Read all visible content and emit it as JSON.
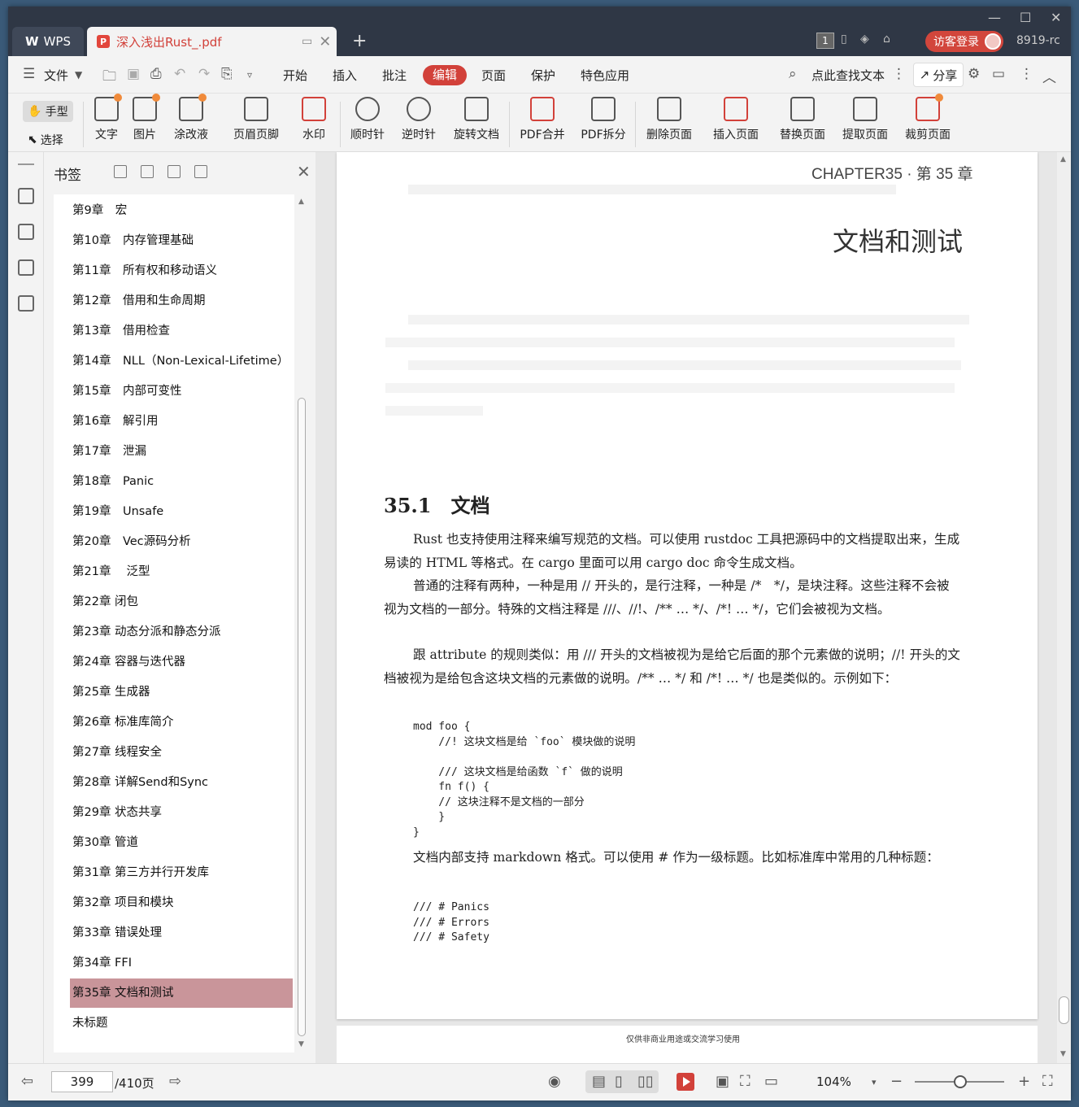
{
  "titlebar": {
    "wps_label": "WPS",
    "doc_tab_title": "深入浅出Rust_.pdf",
    "page_badge": "1",
    "login_label": "访客登录",
    "version": "8919-rc"
  },
  "menu": {
    "file": "文件",
    "items": [
      "开始",
      "插入",
      "批注",
      "编辑",
      "页面",
      "保护",
      "特色应用"
    ],
    "search_text": "点此查找文本",
    "share": "分享"
  },
  "ribbon": {
    "hand": "手型",
    "select": "选择",
    "tools": [
      "文字",
      "图片",
      "涂改液",
      "页眉页脚",
      "水印",
      "顺时针",
      "逆时针",
      "旋转文档",
      "PDF合并",
      "PDF拆分",
      "删除页面",
      "插入页面",
      "替换页面",
      "提取页面",
      "裁剪页面"
    ]
  },
  "bookmark": {
    "title": "书签",
    "items": [
      "第9章　宏",
      "第10章　内存管理基础",
      "第11章　所有权和移动语义",
      "第12章　借用和生命周期",
      "第13章　借用检查",
      "第14章　NLL（Non-Lexical-Lifetime）",
      "第15章　内部可变性",
      "第16章　解引用",
      "第17章　泄漏",
      "第18章　Panic",
      "第19章　Unsafe",
      "第20章　Vec源码分析",
      "第21章　 泛型",
      "第22章 闭包",
      "第23章 动态分派和静态分派",
      "第24章 容器与迭代器",
      "第25章 生成器",
      "第26章 标准库简介",
      "第27章 线程安全",
      "第28章 详解Send和Sync",
      "第29章 状态共享",
      "第30章 管道",
      "第31章 第三方并行开发库",
      "第32章 项目和模块",
      "第33章 错误处理",
      "第34章 FFI",
      "第35章 文档和测试",
      "未标题"
    ],
    "active_index": 26
  },
  "page": {
    "chapter_header": "CHAPTER35 · 第 35 章",
    "chapter_title": "文档和测试",
    "section_title": "35.1　文档",
    "paragraphs": [
      "Rust 也支持使用注释来编写规范的文档。可以使用 rustdoc 工具把源码中的文档提取出来，生成易读的 HTML 等格式。在 cargo 里面可以用 cargo doc 命令生成文档。",
      "普通的注释有两种，一种是用 // 开头的，是行注释，一种是 /*　*/，是块注释。这些注释不会被视为文档的一部分。特殊的文档注释是 ///、//!、/** … */、/*! … */，它们会被视为文档。",
      "跟 attribute 的规则类似：用 /// 开头的文档被视为是给它后面的那个元素做的说明；//! 开头的文档被视为是给包含这块文档的元素做的说明。/** … */ 和 /*! … */ 也是类似的。示例如下：",
      "文档内部支持 markdown 格式。可以使用 # 作为一级标题。比如标准库中常用的几种标题："
    ],
    "code1": "mod foo {\n    //! 这块文档是给 `foo` 模块做的说明\n\n    /// 这块文档是给函数 `f` 做的说明\n    fn f() {\n    // 这块注释不是文档的一部分\n    }\n}",
    "code2": "/// # Panics\n/// # Errors\n/// # Safety",
    "footer_note": "仅供非商业用途或交流学习使用"
  },
  "status": {
    "current_page": "399",
    "total_pages": "/410页",
    "zoom": "104%"
  },
  "colors": {
    "accent": "#d2413a",
    "titlebar": "#2f3745",
    "bookmark_active": "#c9959a"
  }
}
